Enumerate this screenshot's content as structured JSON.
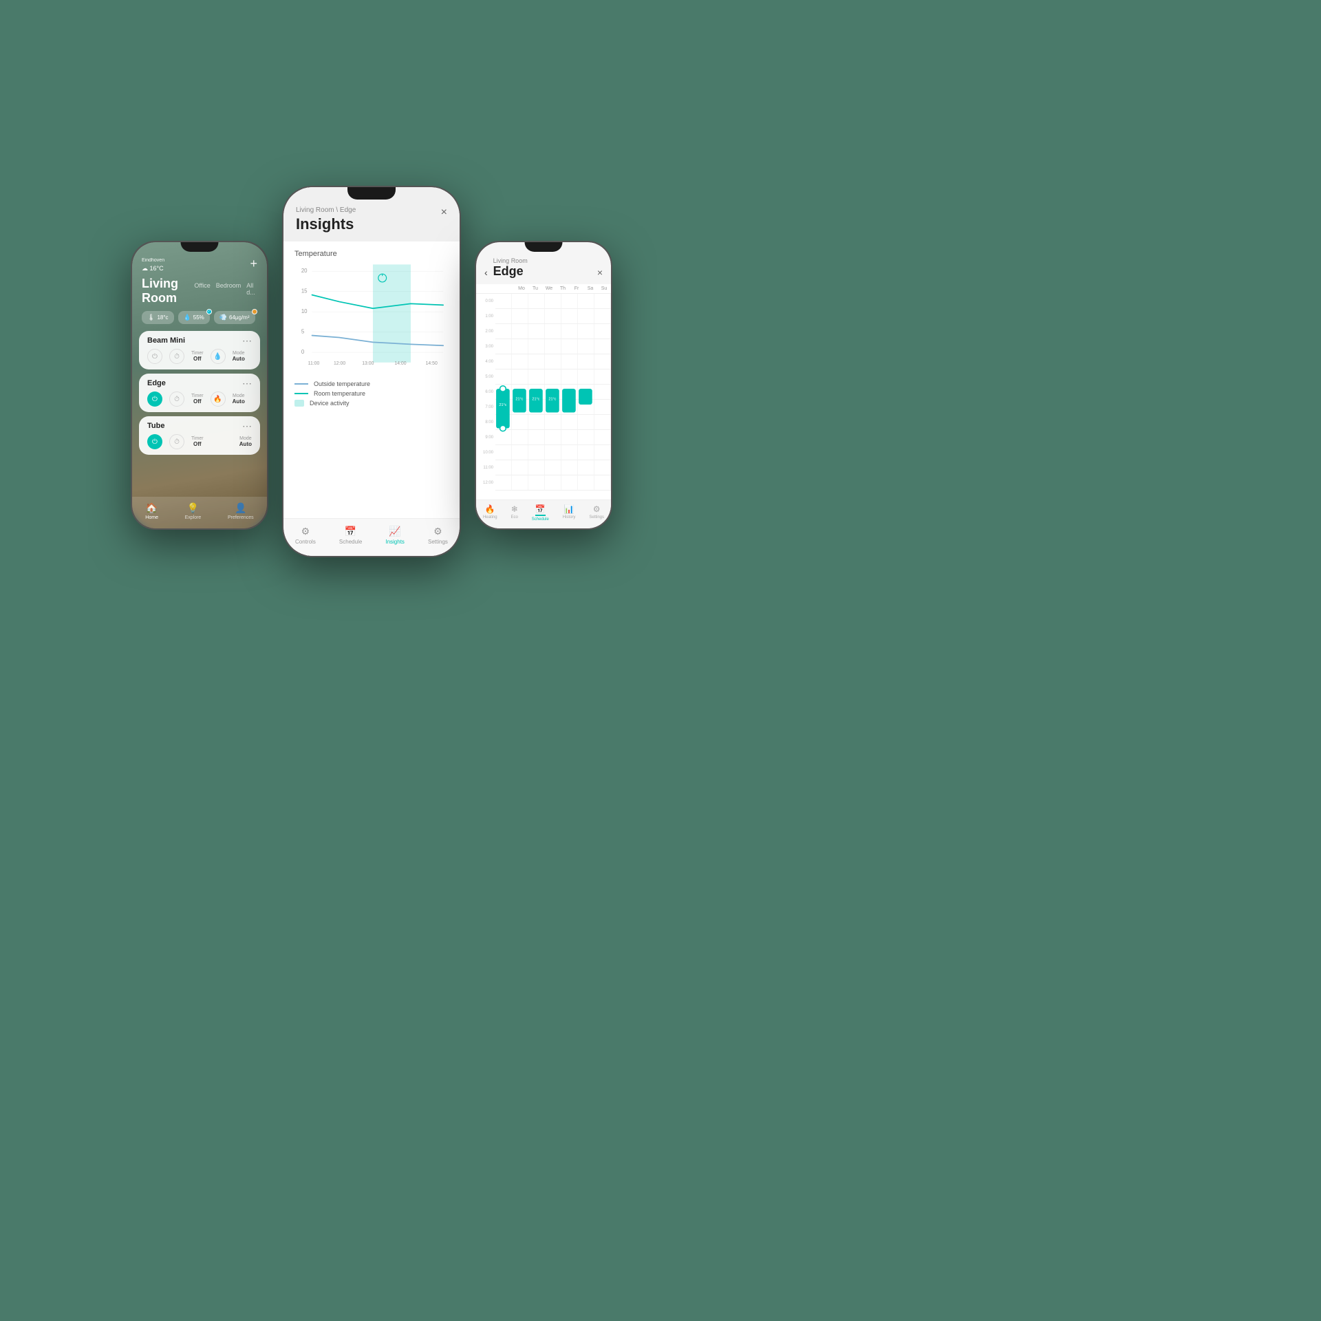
{
  "left_phone": {
    "city": "Eindhoven",
    "weather_icon": "☁",
    "temperature": "16°C",
    "plus_btn": "+",
    "room_name": "Living Room",
    "room_tabs": [
      "Office",
      "Bedroom",
      "All d..."
    ],
    "stats": [
      {
        "icon": "🌡",
        "value": "18°c",
        "badge": null
      },
      {
        "icon": "💧",
        "value": "55%",
        "badge": "check"
      },
      {
        "icon": "💨",
        "value": "64μg/m²",
        "badge": "warning"
      }
    ],
    "cards": [
      {
        "name": "Beam Mini",
        "controls": [
          {
            "type": "power",
            "active": false
          },
          {
            "type": "timer",
            "active": false
          },
          {
            "label_top": "Timer",
            "label_val": "Off"
          },
          {
            "type": "drop",
            "active": false
          },
          {
            "label_top": "Mode",
            "label_val": "Auto"
          }
        ]
      },
      {
        "name": "Edge",
        "controls": [
          {
            "type": "power",
            "active": true
          },
          {
            "type": "timer",
            "active": false
          },
          {
            "label_top": "Timer",
            "label_val": "Off"
          },
          {
            "type": "flame",
            "active": false
          },
          {
            "label_top": "Mode",
            "label_val": "Auto"
          }
        ]
      },
      {
        "name": "Tube",
        "controls": [
          {
            "type": "power",
            "active": true
          },
          {
            "type": "timer",
            "active": false
          },
          {
            "label_top": "Timer",
            "label_val": "Off"
          },
          {
            "label_top": "Mode",
            "label_val": "Auto"
          }
        ]
      }
    ],
    "bottom_nav": [
      {
        "icon": "🏠",
        "label": "Home",
        "active": true
      },
      {
        "icon": "💡",
        "label": "Explore",
        "active": false
      },
      {
        "icon": "👤",
        "label": "Preferences",
        "active": false
      }
    ]
  },
  "center_phone": {
    "breadcrumb": "Living Room \\ Edge",
    "title": "Insights",
    "close_btn": "×",
    "chart": {
      "title": "Temperature",
      "y_labels": [
        "20",
        "15",
        "10",
        "5",
        "0"
      ],
      "x_labels": [
        "11:00",
        "12:00",
        "13:00",
        "14:00",
        "14:50"
      ],
      "outside_temp_color": "#7ab0d4",
      "room_temp_color": "#00c4b4",
      "activity_color": "rgba(0,196,180,0.2)"
    },
    "legend": [
      {
        "type": "line",
        "color": "#7ab0d4",
        "label": "Outside temperature"
      },
      {
        "type": "line",
        "color": "#00c4b4",
        "label": "Room temperature"
      },
      {
        "type": "box",
        "color": "rgba(0,196,180,0.2)",
        "label": "Device activity"
      }
    ],
    "bottom_nav": [
      {
        "icon": "⚙",
        "label": "Controls",
        "active": false
      },
      {
        "icon": "📅",
        "label": "Schedule",
        "active": false
      },
      {
        "icon": "📈",
        "label": "Insights",
        "active": true
      },
      {
        "icon": "⚙",
        "label": "Settings",
        "active": false
      }
    ]
  },
  "right_phone": {
    "back_btn": "‹",
    "breadcrumb": "Living Room",
    "title": "Edge",
    "close_btn": "×",
    "schedule_days": [
      "Mo",
      "Tu",
      "We",
      "Th",
      "Fr",
      "Sa",
      "Su"
    ],
    "time_labels": [
      "0:00",
      "1:00",
      "2:00",
      "3:00",
      "4:00",
      "5:00",
      "6:00",
      "7:00",
      "8:00",
      "9:00",
      "10:00",
      "11:00",
      "12:00"
    ],
    "temp_label": "21°c",
    "bottom_nav": [
      {
        "icon": "🔥",
        "label": "Heating",
        "active": false
      },
      {
        "icon": "🌿",
        "label": "Eco",
        "active": false
      },
      {
        "icon": "📅",
        "label": "Schedule",
        "active": true
      },
      {
        "icon": "📊",
        "label": "History",
        "active": false
      },
      {
        "icon": "⚙",
        "label": "Settings",
        "active": false
      }
    ]
  }
}
